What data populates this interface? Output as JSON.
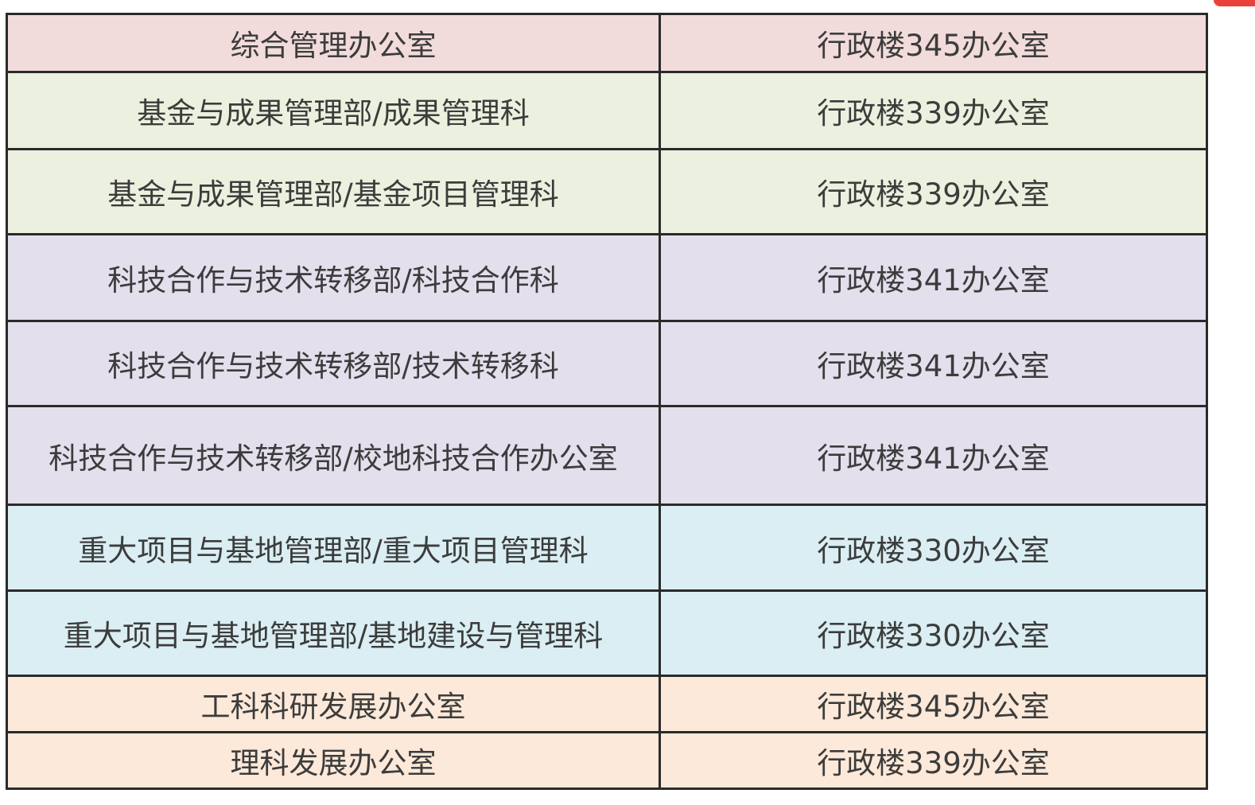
{
  "table": {
    "rows": [
      {
        "department": "综合管理办公室",
        "location": "行政楼345办公室",
        "group": "pink"
      },
      {
        "department": "基金与成果管理部/成果管理科",
        "location": "行政楼339办公室",
        "group": "green"
      },
      {
        "department": "基金与成果管理部/基金项目管理科",
        "location": "行政楼339办公室",
        "group": "green"
      },
      {
        "department": "科技合作与技术转移部/科技合作科",
        "location": "行政楼341办公室",
        "group": "purple"
      },
      {
        "department": "科技合作与技术转移部/技术转移科",
        "location": "行政楼341办公室",
        "group": "purple"
      },
      {
        "department": "科技合作与技术转移部/校地科技合作办公室",
        "location": "行政楼341办公室",
        "group": "purple"
      },
      {
        "department": "重大项目与基地管理部/重大项目管理科",
        "location": "行政楼330办公室",
        "group": "blue"
      },
      {
        "department": "重大项目与基地管理部/基地建设与管理科",
        "location": "行政楼330办公室",
        "group": "blue"
      },
      {
        "department": "工科科研发展办公室",
        "location": "行政楼345办公室",
        "group": "peach"
      },
      {
        "department": "理科发展办公室",
        "location": "行政楼339办公室",
        "group": "peach"
      }
    ]
  },
  "colors": {
    "pink": "#f2dcdb",
    "green": "#ebf1de",
    "purple": "#e4dfec",
    "blue": "#daeef3",
    "peach": "#fde9d9",
    "border": "#2a2a2a",
    "text": "#3c3c3c"
  }
}
